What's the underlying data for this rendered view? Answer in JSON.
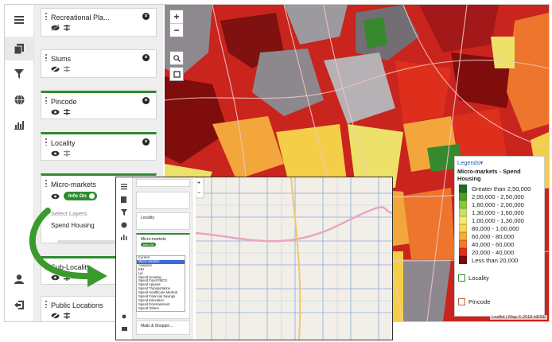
{
  "rail": {
    "icons": [
      "menu-icon",
      "layers-icon",
      "filter-icon",
      "globe-icon",
      "bar-chart-icon"
    ],
    "bottom_icons": [
      "user-icon",
      "logout-icon"
    ]
  },
  "layers": [
    {
      "name": "Recreational Pla...",
      "visible": false
    },
    {
      "name": "Slums",
      "visible": false
    },
    {
      "name": "Pincode",
      "visible": true
    },
    {
      "name": "Locality",
      "visible": true
    },
    {
      "name": "Micro-markets",
      "visible": true,
      "toggle": "Info On",
      "select_label": "Select Layers",
      "selected": "Spend Housing"
    },
    {
      "name": "Sub-Locality",
      "visible": true
    },
    {
      "name": "Public Locations",
      "visible": false
    }
  ],
  "map": {
    "zoom_in": "+",
    "zoom_out": "−",
    "attribution": "Leaflet | Map © 2018 HERE"
  },
  "legend": {
    "header": "Legends▾",
    "title": "Micro-markets - Spend Housing",
    "items": [
      {
        "label": "Greater than 2,50,000",
        "color": "#1f6b1f"
      },
      {
        "label": "2,00,000 - 2,50,000",
        "color": "#4e9e2a"
      },
      {
        "label": "1,60,000 - 2,00,000",
        "color": "#8cc83c"
      },
      {
        "label": "1,30,000 - 1,60,000",
        "color": "#c7e06a"
      },
      {
        "label": "1,00,000 - 1,30,000",
        "color": "#f0ec6e"
      },
      {
        "label": "80,000 - 1,00,000",
        "color": "#f7d84a"
      },
      {
        "label": "60,000 - 80,000",
        "color": "#f5ae3e"
      },
      {
        "label": "40,000 - 60,000",
        "color": "#ef7a2e"
      },
      {
        "label": "20,000 - 40,000",
        "color": "#e0301e"
      },
      {
        "label": "Less than 20,000",
        "color": "#7a0c0c"
      }
    ],
    "locality": "Locality",
    "pincode": "Pincode",
    "locality_color": "#2e8b2e",
    "pincode_color": "#c0603a"
  },
  "inset": {
    "cards": [
      "Locality",
      "Micro-markets",
      "Malls & Shoppin..."
    ],
    "toggle": "Info On",
    "dropdown": [
      "Current",
      "Micro-markets",
      "Analytics",
      "EBI",
      "Lpi",
      "Spend Housing",
      "Spend Food FMCG",
      "Spend Apparel",
      "Spend Transportation",
      "Spend Healthcare Medical",
      "Spend Financial Savings",
      "Spend Education",
      "Spend Entertainment",
      "Spend Others"
    ]
  }
}
